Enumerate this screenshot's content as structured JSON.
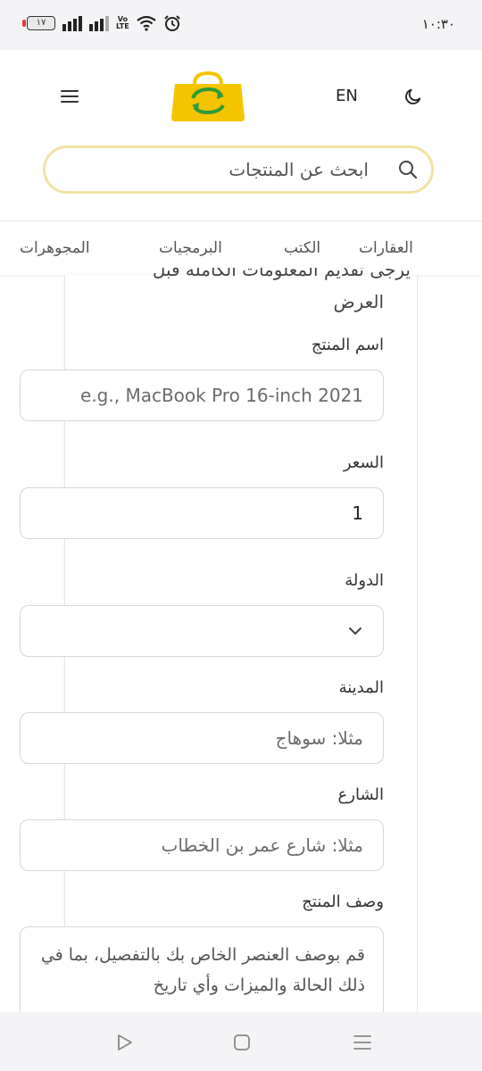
{
  "status_bar": {
    "time": "١٠:٣٠",
    "battery": "١٧",
    "network": "Vo LTE"
  },
  "header": {
    "language_toggle": "EN"
  },
  "search": {
    "placeholder": "ابحث عن المنتجات"
  },
  "categories": [
    {
      "label": "العقارات"
    },
    {
      "label": "الكتب"
    },
    {
      "label": "البرمجيات"
    },
    {
      "label": "المجوهرات"
    }
  ],
  "form": {
    "clipped_text": "يرجى تقديم المعلومات الكاملة قبل",
    "intro_end": "العرض",
    "product_name": {
      "label": "اسم المنتج",
      "placeholder": "e.g., MacBook Pro 16-inch 2021"
    },
    "price": {
      "label": "السعر",
      "value": "1"
    },
    "country": {
      "label": "الدولة",
      "value": ""
    },
    "city": {
      "label": "المدينة",
      "placeholder": "مثلا: سوهاج"
    },
    "street": {
      "label": "الشارع",
      "placeholder": "مثلا: شارع عمر بن الخطاب"
    },
    "description": {
      "label": "وصف المنتج",
      "placeholder": "قم بوصف العنصر الخاص بك بالتفصيل، بما في ذلك الحالة والميزات وأي تاريخ"
    }
  },
  "colors": {
    "search_border": "#f2e2a4",
    "logo_bag": "#f5c400",
    "logo_arrows": "#2e9b3a"
  }
}
